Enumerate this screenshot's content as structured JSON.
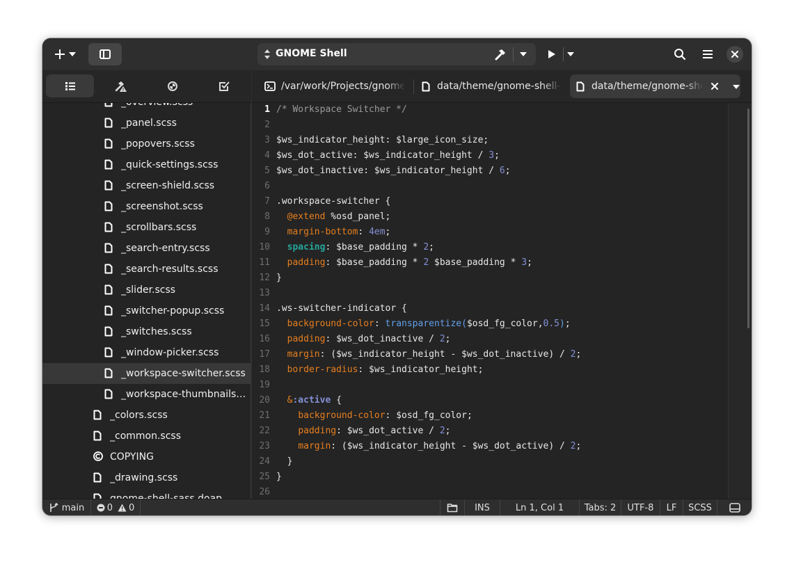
{
  "header": {
    "build_target": "GNOME Shell"
  },
  "sidebar": {
    "tabs": [
      {
        "name": "project-tree",
        "icon": "list-icon",
        "active": true
      },
      {
        "name": "build",
        "icon": "build-warning-icon",
        "active": false
      },
      {
        "name": "symbols",
        "icon": "globe-icon",
        "active": false
      },
      {
        "name": "todo",
        "icon": "checkbox-icon",
        "active": false
      }
    ],
    "tree": [
      {
        "label": "_overview.scss",
        "icon": "file-icon",
        "depth": 2
      },
      {
        "label": "_panel.scss",
        "icon": "file-icon",
        "depth": 2
      },
      {
        "label": "_popovers.scss",
        "icon": "file-icon",
        "depth": 2
      },
      {
        "label": "_quick-settings.scss",
        "icon": "file-icon",
        "depth": 2
      },
      {
        "label": "_screen-shield.scss",
        "icon": "file-icon",
        "depth": 2
      },
      {
        "label": "_screenshot.scss",
        "icon": "file-icon",
        "depth": 2
      },
      {
        "label": "_scrollbars.scss",
        "icon": "file-icon",
        "depth": 2
      },
      {
        "label": "_search-entry.scss",
        "icon": "file-icon",
        "depth": 2
      },
      {
        "label": "_search-results.scss",
        "icon": "file-icon",
        "depth": 2
      },
      {
        "label": "_slider.scss",
        "icon": "file-icon",
        "depth": 2
      },
      {
        "label": "_switcher-popup.scss",
        "icon": "file-icon",
        "depth": 2
      },
      {
        "label": "_switches.scss",
        "icon": "file-icon",
        "depth": 2
      },
      {
        "label": "_window-picker.scss",
        "icon": "file-icon",
        "depth": 2
      },
      {
        "label": "_workspace-switcher.scss",
        "icon": "file-icon",
        "depth": 2,
        "selected": true
      },
      {
        "label": "_workspace-thumbnails.scss",
        "icon": "file-icon",
        "depth": 2
      },
      {
        "label": "_colors.scss",
        "icon": "file-icon",
        "depth": 1
      },
      {
        "label": "_common.scss",
        "icon": "file-icon",
        "depth": 1
      },
      {
        "label": "COPYING",
        "icon": "copyright-icon",
        "depth": 1
      },
      {
        "label": "_drawing.scss",
        "icon": "file-icon",
        "depth": 1
      },
      {
        "label": "gnome-shell-sass.doap",
        "icon": "file-icon",
        "depth": 1
      }
    ]
  },
  "tabs": [
    {
      "label": "/var/work/Projects/gnome-shell",
      "icon": "terminal-icon",
      "active": false
    },
    {
      "label": "data/theme/gnome-shell-sass/_common.scss",
      "icon": "file-icon",
      "active": false
    },
    {
      "label": "data/theme/gnome-shell-sass/widgets/_workspace-switcher.scss",
      "icon": "file-icon",
      "active": true
    }
  ],
  "editor": {
    "current_line": 1,
    "lines": [
      [
        [
          "c",
          "/* Workspace Switcher */"
        ]
      ],
      [],
      [
        [
          "t",
          "$ws_indicator_height: $large_icon_size;"
        ]
      ],
      [
        [
          "t",
          "$ws_dot_active: $ws_indicator_height / "
        ],
        [
          "n",
          "3"
        ],
        [
          "t",
          ";"
        ]
      ],
      [
        [
          "t",
          "$ws_dot_inactive: $ws_indicator_height / "
        ],
        [
          "n",
          "6"
        ],
        [
          "t",
          ";"
        ]
      ],
      [],
      [
        [
          "t",
          ".workspace-switcher {"
        ]
      ],
      [
        [
          "t",
          "  "
        ],
        [
          "p",
          "@extend"
        ],
        [
          "t",
          " %osd_panel;"
        ]
      ],
      [
        [
          "t",
          "  "
        ],
        [
          "p",
          "margin-bottom"
        ],
        [
          "t",
          ": "
        ],
        [
          "n",
          "4em"
        ],
        [
          "t",
          ";"
        ]
      ],
      [
        [
          "t",
          "  "
        ],
        [
          "k",
          "spacing"
        ],
        [
          "t",
          ": $base_padding * "
        ],
        [
          "n",
          "2"
        ],
        [
          "t",
          ";"
        ]
      ],
      [
        [
          "t",
          "  "
        ],
        [
          "p",
          "padding"
        ],
        [
          "t",
          ": $base_padding * "
        ],
        [
          "n",
          "2"
        ],
        [
          "t",
          " $base_padding * "
        ],
        [
          "n",
          "3"
        ],
        [
          "t",
          ";"
        ]
      ],
      [
        [
          "t",
          "}"
        ]
      ],
      [],
      [
        [
          "t",
          ".ws-switcher-indicator {"
        ]
      ],
      [
        [
          "t",
          "  "
        ],
        [
          "p",
          "background-color"
        ],
        [
          "t",
          ": "
        ],
        [
          "f",
          "transparentize("
        ],
        [
          "t",
          "$osd_fg_color,"
        ],
        [
          "n",
          "0.5"
        ],
        [
          "f",
          ")"
        ],
        [
          "t",
          ";"
        ]
      ],
      [
        [
          "t",
          "  "
        ],
        [
          "p",
          "padding"
        ],
        [
          "t",
          ": $ws_dot_inactive / "
        ],
        [
          "n",
          "2"
        ],
        [
          "t",
          ";"
        ]
      ],
      [
        [
          "t",
          "  "
        ],
        [
          "p",
          "margin"
        ],
        [
          "t",
          ": ($ws_indicator_height - $ws_dot_inactive) / "
        ],
        [
          "n",
          "2"
        ],
        [
          "t",
          ";"
        ]
      ],
      [
        [
          "t",
          "  "
        ],
        [
          "p",
          "border-radius"
        ],
        [
          "t",
          ": $ws_indicator_height;"
        ]
      ],
      [],
      [
        [
          "t",
          "  "
        ],
        [
          "p",
          "&"
        ],
        [
          "s",
          ":active"
        ],
        [
          "t",
          " {"
        ]
      ],
      [
        [
          "t",
          "    "
        ],
        [
          "p",
          "background-color"
        ],
        [
          "t",
          ": $osd_fg_color;"
        ]
      ],
      [
        [
          "t",
          "    "
        ],
        [
          "p",
          "padding"
        ],
        [
          "t",
          ": $ws_dot_active / "
        ],
        [
          "n",
          "2"
        ],
        [
          "t",
          ";"
        ]
      ],
      [
        [
          "t",
          "    "
        ],
        [
          "p",
          "margin"
        ],
        [
          "t",
          ": ($ws_indicator_height - $ws_dot_active) / "
        ],
        [
          "n",
          "2"
        ],
        [
          "t",
          ";"
        ]
      ],
      [
        [
          "t",
          "  }"
        ]
      ],
      [
        [
          "t",
          "}"
        ]
      ],
      []
    ]
  },
  "status": {
    "branch": "main",
    "errors": "0",
    "warnings": "0",
    "mode": "INS",
    "position": "Ln 1, Col 1",
    "tabs": "Tabs: 2",
    "encoding": "UTF-8",
    "line_ending": "LF",
    "language": "SCSS"
  },
  "colors": {
    "property": "#e77f1f",
    "number": "#8490d6",
    "function": "#62a0ea",
    "keyword": "#26a69a",
    "comment": "#9a9a9a"
  }
}
